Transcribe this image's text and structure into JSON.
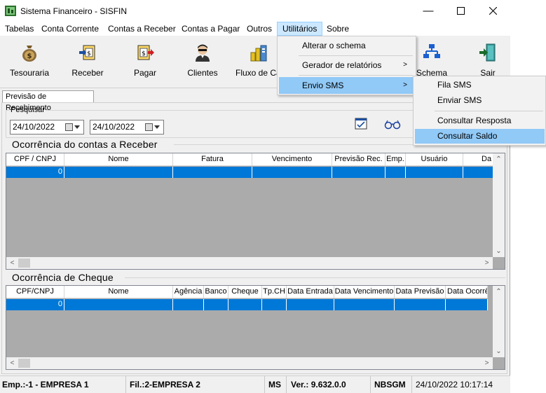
{
  "window": {
    "title": "Sistema Financeiro - SISFIN"
  },
  "menubar": [
    {
      "label": "Tabelas"
    },
    {
      "label": "Conta Corrente"
    },
    {
      "label": "Contas a Receber"
    },
    {
      "label": "Contas a Pagar"
    },
    {
      "label": "Outros"
    },
    {
      "label": "Utilitários"
    },
    {
      "label": "Sobre"
    }
  ],
  "toolbar": {
    "buttons": [
      {
        "label": "Tesouraria",
        "icon": "money-bag-icon"
      },
      {
        "label": "Receber",
        "icon": "receive-icon"
      },
      {
        "label": "Pagar",
        "icon": "pay-icon"
      },
      {
        "label": "Clientes",
        "icon": "clients-icon"
      },
      {
        "label": "Fluxo de Cai",
        "icon": "cash-flow-icon"
      },
      {
        "label": "Schema",
        "icon": "schema-icon"
      },
      {
        "label": "Sair",
        "icon": "exit-icon"
      }
    ]
  },
  "tab": {
    "label": "Previsão de Recebimento"
  },
  "search": {
    "legend": "Pesquisar",
    "date_from": "24/10/2022",
    "date_to": "24/10/2022"
  },
  "grid_receber": {
    "title": "Ocorrência do contas a Receber",
    "columns": [
      "CPF / CNPJ",
      "Nome",
      "Fatura",
      "Vencimento",
      "Previsão Rec.",
      "Emp.",
      "Usuário",
      "Da"
    ],
    "rows": [
      [
        "0",
        "",
        "",
        "",
        "",
        "",
        "",
        ""
      ]
    ]
  },
  "grid_cheque": {
    "title": "Ocorrência de Cheque",
    "columns": [
      "CPF/CNPJ",
      "Nome",
      "Agência",
      "Banco",
      "Cheque",
      "Tp.CH",
      "Data Entrada",
      "Data Vencimento",
      "Data Previsão",
      "Data Ocorrê"
    ],
    "rows": [
      [
        "0",
        "",
        "",
        "",
        "",
        "",
        "",
        "",
        "",
        ""
      ]
    ]
  },
  "statusbar": {
    "emp": "Emp.:-1 - EMPRESA 1",
    "fil": "Fil.:2-EMPRESA 2",
    "uf": "MS",
    "version": "Ver.: 9.632.0.0",
    "user": "NBSGM",
    "datetime": "24/10/2022 10:17:14"
  },
  "utilitarios_menu": {
    "items": [
      {
        "label": "Alterar o schema",
        "has_sub": false
      },
      {
        "label": "Gerador de relatórios",
        "has_sub": true
      },
      {
        "label": "Envio SMS",
        "has_sub": true
      }
    ]
  },
  "sms_submenu": {
    "items": [
      {
        "label": "Fila SMS"
      },
      {
        "label": "Enviar SMS"
      },
      {
        "label": "Consultar Resposta"
      },
      {
        "label": "Consultar Saldo"
      }
    ]
  },
  "colors": {
    "selection": "#0078d7",
    "menu_highlight": "#91c9f7",
    "grid_bg": "#ababab"
  }
}
